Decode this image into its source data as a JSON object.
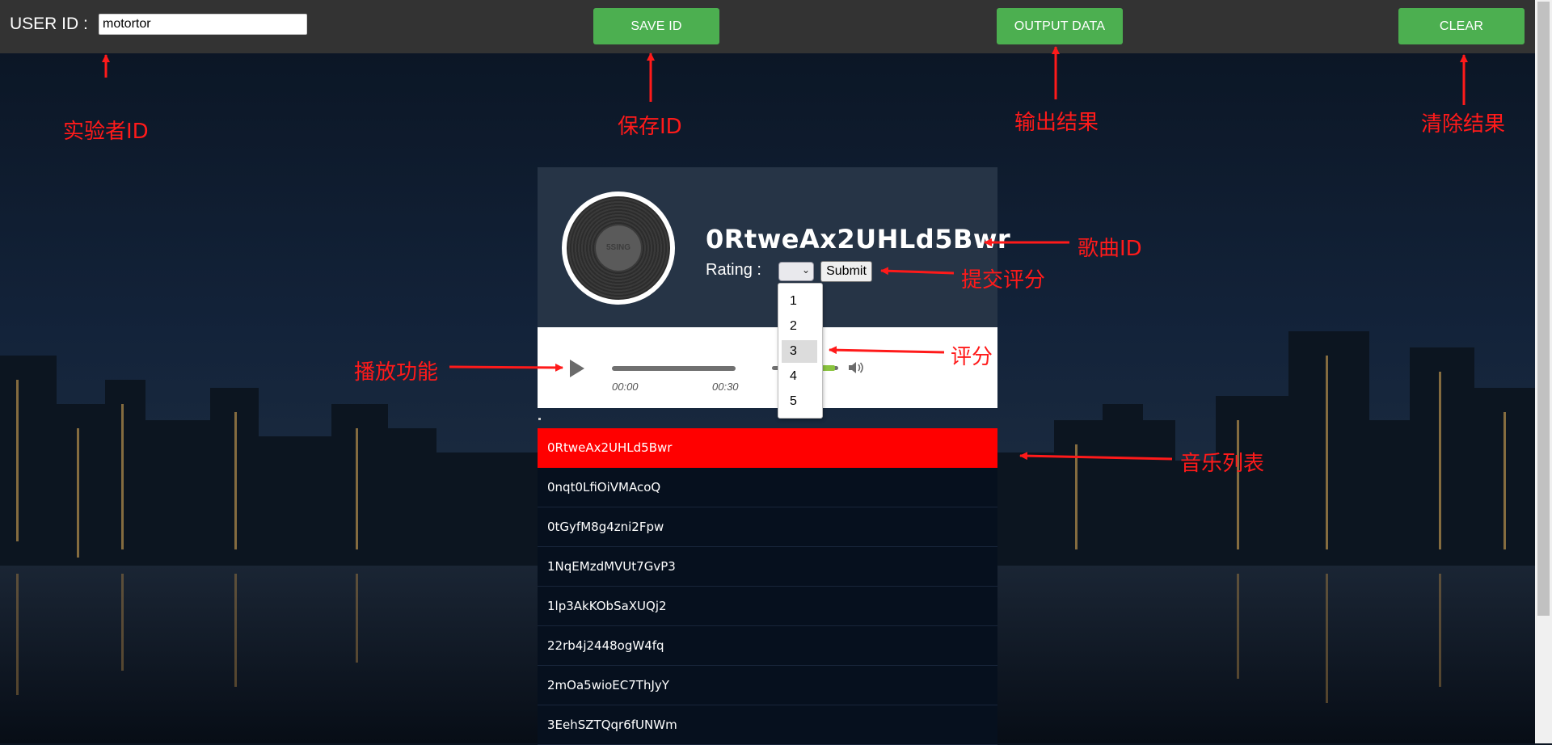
{
  "topbar": {
    "user_id_label": "USER ID :",
    "user_id_value": "motortor",
    "save_label": "SAVE ID",
    "output_label": "OUTPUT DATA",
    "clear_label": "CLEAR"
  },
  "player": {
    "disc_label": "5SING",
    "song_title": "0RtweAx2UHLd5Bwr",
    "rating_label": "Rating :",
    "submit_label": "Submit",
    "current_time": "00:00",
    "duration": "00:30",
    "rating_options": [
      "1",
      "2",
      "3",
      "4",
      "5"
    ],
    "highlighted_option": "3"
  },
  "playlist": [
    "0RtweAx2UHLd5Bwr",
    "0nqt0LfiOiVMAcoQ",
    "0tGyfM8g4zni2Fpw",
    "1NqEMzdMVUt7GvP3",
    "1lp3AkKObSaXUQj2",
    "22rb4j2448ogW4fq",
    "2mOa5wioEC7ThJyY",
    "3EehSZTQqr6fUNWm"
  ],
  "active_track": "0RtweAx2UHLd5Bwr",
  "annotations": {
    "user_id": "实验者ID",
    "save_id": "保存ID",
    "output": "输出结果",
    "clear": "清除结果",
    "song_id": "歌曲ID",
    "submit_rating": "提交评分",
    "rating": "评分",
    "play": "播放功能",
    "music_list": "音乐列表"
  },
  "colors": {
    "topbar": "#333333",
    "button_green": "#4caf50",
    "annotation_red": "#ff1a1a",
    "active_track": "#ff0000",
    "player_head": "#263446"
  }
}
